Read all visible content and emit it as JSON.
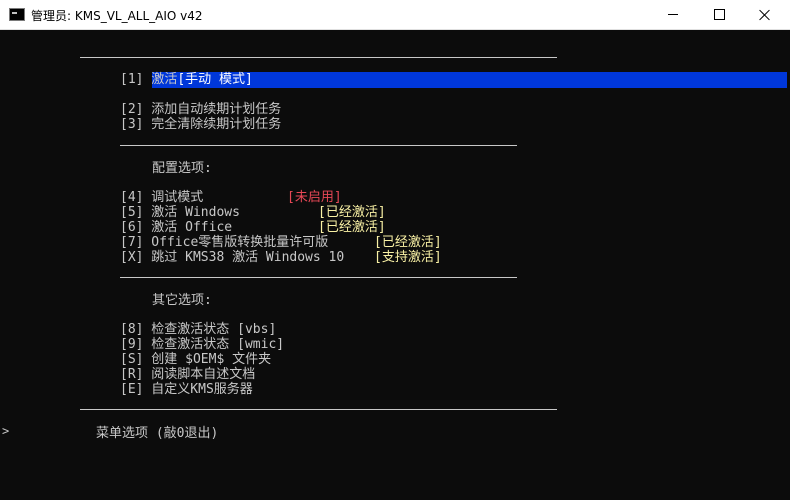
{
  "window": {
    "title": "管理员:  KMS_VL_ALL_AIO v42",
    "minimize_icon": "minimize-icon",
    "maximize_icon": "maximize-icon",
    "close_icon": "close-icon"
  },
  "menu": {
    "item1_key": "[1]",
    "item1_label": "激活",
    "item1_value": "[手动 模式]",
    "item2": "[2] 添加自动续期计划任务",
    "item3": "[3] 完全清除续期计划任务",
    "config_header": "配置选项:",
    "item4_label": "[4] 调试模式",
    "item4_value": "[未启用]",
    "item5_label": "[5] 激活 Windows",
    "item5_value": "[已经激活]",
    "item6_label": "[6] 激活 Office",
    "item6_value": "[已经激活]",
    "item7_label": "[7] Office零售版转换批量许可版",
    "item7_value": "[已经激活]",
    "itemX_label": "[X] 跳过 KMS38 激活 Windows 10",
    "itemX_value": "[支持激活]",
    "other_header": "其它选项:",
    "item8": "[8] 检查激活状态 [vbs]",
    "item9": "[9] 检查激活状态 [wmic]",
    "itemS": "[S] 创建 $OEM$ 文件夹",
    "itemR": "[R] 阅读脚本自述文档",
    "itemE": "[E] 自定义KMS服务器",
    "prompt": "菜单选项 (敲0退出)",
    "prompt_arrow": ">"
  },
  "colors": {
    "highlight": "#0037da",
    "status_red": "#e74856",
    "status_yellow": "#f9f1a5",
    "console_bg": "#0c0c0c",
    "console_fg": "#c8c8c8"
  }
}
